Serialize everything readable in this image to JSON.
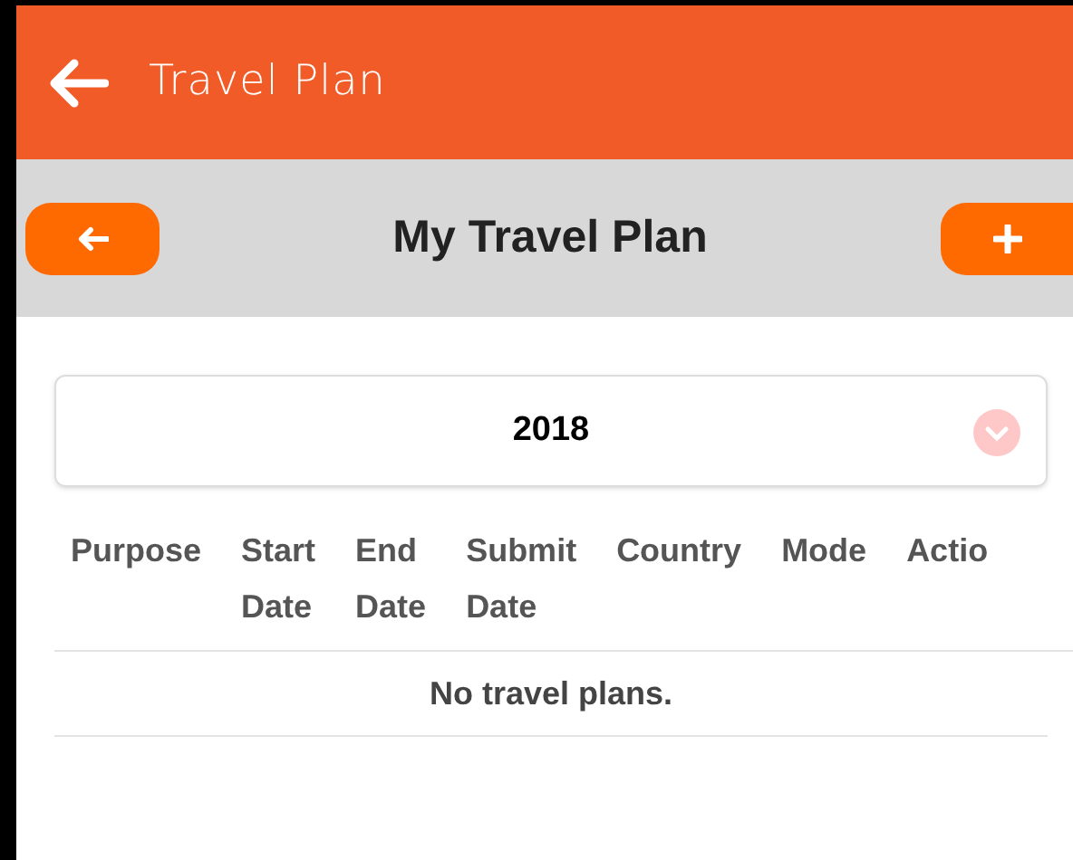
{
  "app_bar": {
    "title": "Travel Plan"
  },
  "toolbar": {
    "title": "My Travel Plan"
  },
  "year_select": {
    "value": "2018"
  },
  "table": {
    "columns": [
      [
        "Purpose"
      ],
      [
        "Start",
        "Date"
      ],
      [
        "End",
        "Date"
      ],
      [
        "Submit",
        "Date"
      ],
      [
        "Country"
      ],
      [
        "Mode"
      ],
      [
        "Actio"
      ]
    ],
    "empty_message": "No travel plans."
  }
}
